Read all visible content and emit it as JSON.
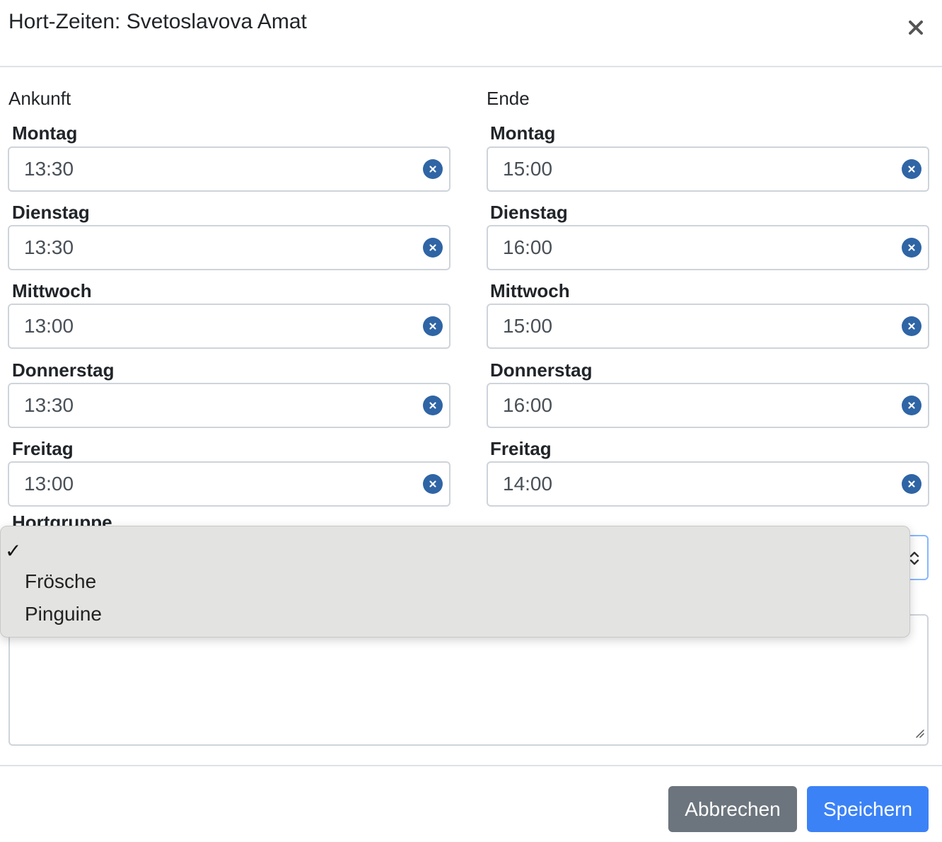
{
  "modal": {
    "title": "Hort-Zeiten: Svetoslavova Amat"
  },
  "ankunft": {
    "heading": "Ankunft",
    "days": [
      {
        "label": "Montag",
        "value": "13:30"
      },
      {
        "label": "Dienstag",
        "value": "13:30"
      },
      {
        "label": "Mittwoch",
        "value": "13:00"
      },
      {
        "label": "Donnerstag",
        "value": "13:30"
      },
      {
        "label": "Freitag",
        "value": "13:00"
      }
    ]
  },
  "ende": {
    "heading": "Ende",
    "days": [
      {
        "label": "Montag",
        "value": "15:00"
      },
      {
        "label": "Dienstag",
        "value": "16:00"
      },
      {
        "label": "Mittwoch",
        "value": "15:00"
      },
      {
        "label": "Donnerstag",
        "value": "16:00"
      },
      {
        "label": "Freitag",
        "value": "14:00"
      }
    ]
  },
  "hortgruppe": {
    "label": "Hortgruppe",
    "selected": "",
    "options": [
      "",
      "Frösche",
      "Pinguine"
    ],
    "checkmark": "✓"
  },
  "footer": {
    "cancel_label": "Abbrechen",
    "save_label": "Speichern"
  },
  "colors": {
    "clear_icon": "#2f65a5",
    "primary": "#3b82f6",
    "secondary": "#6c757d",
    "dropdown_bg": "#e3e3e1"
  },
  "icons": {
    "close": "close-icon",
    "clear": "clear-icon",
    "select_arrows": "chevron-up-down-icon",
    "resize": "resize-grip-icon",
    "check": "checkmark-icon"
  }
}
